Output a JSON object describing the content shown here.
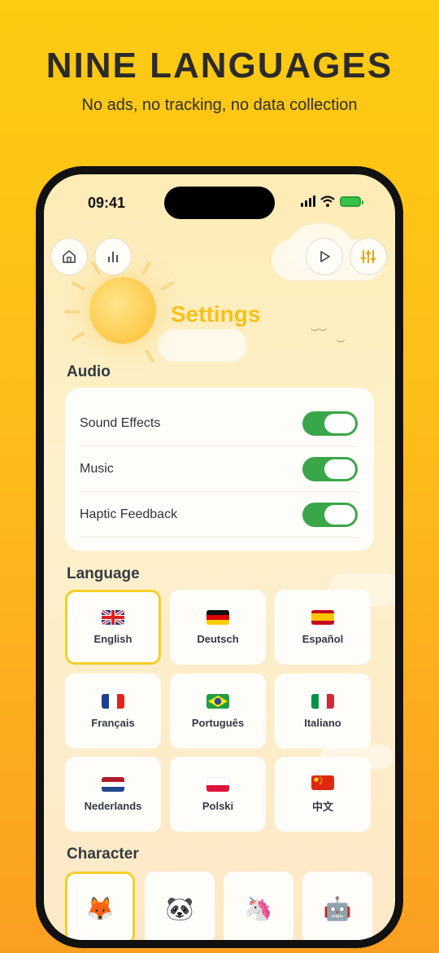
{
  "headline": "NINE LANGUAGES",
  "subline": "No ads, no tracking, no data collection",
  "status": {
    "time": "09:41"
  },
  "toolbar": {
    "home_icon": "home-icon",
    "stats_icon": "stats-icon",
    "play_icon": "play-icon",
    "sliders_icon": "sliders-icon"
  },
  "title": "Settings",
  "audio": {
    "label": "Audio",
    "rows": [
      {
        "label": "Sound Effects",
        "on": true
      },
      {
        "label": "Music",
        "on": true
      },
      {
        "label": "Haptic Feedback",
        "on": true
      }
    ]
  },
  "language": {
    "label": "Language",
    "selected": "English",
    "options": [
      {
        "name": "English",
        "flag": "uk-flag"
      },
      {
        "name": "Deutsch",
        "flag": "germany-flag"
      },
      {
        "name": "Español",
        "flag": "spain-flag"
      },
      {
        "name": "Français",
        "flag": "france-flag"
      },
      {
        "name": "Português",
        "flag": "brazil-flag"
      },
      {
        "name": "Italiano",
        "flag": "italy-flag"
      },
      {
        "name": "Nederlands",
        "flag": "netherlands-flag"
      },
      {
        "name": "Polski",
        "flag": "poland-flag"
      },
      {
        "name": "中文",
        "flag": "china-flag"
      }
    ]
  },
  "character": {
    "label": "Character",
    "options": [
      {
        "glyph": "🦊",
        "icon": "fox-icon",
        "selected": true
      },
      {
        "glyph": "🐼",
        "icon": "panda-icon",
        "selected": false
      },
      {
        "glyph": "🦄",
        "icon": "unicorn-icon",
        "selected": false
      },
      {
        "glyph": "🤖",
        "icon": "robot-icon",
        "selected": false
      }
    ]
  },
  "colors": {
    "accent": "#f7c01a",
    "toggle_on": "#3aa64a",
    "selected_border": "#f3cf27"
  }
}
